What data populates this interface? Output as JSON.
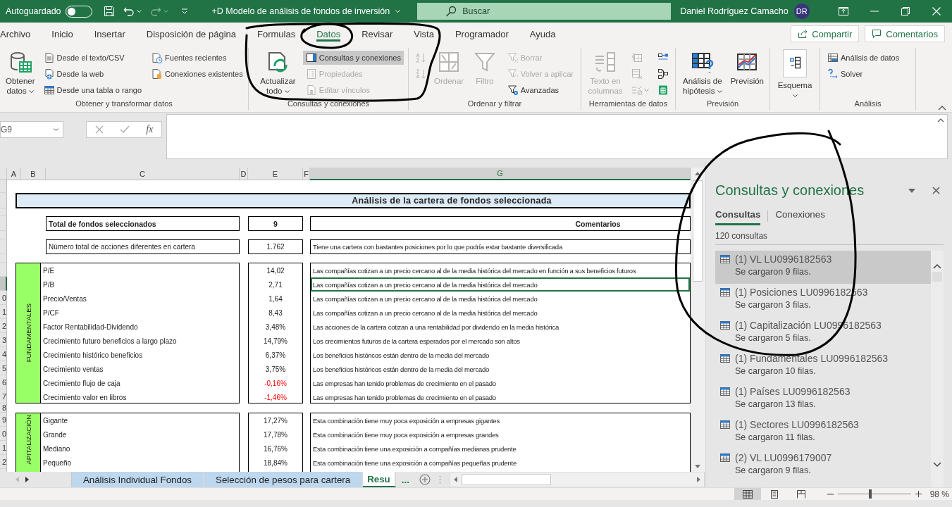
{
  "title_bar": {
    "autosave_label": "Autoguardado",
    "autosave_on": false,
    "document_title": "+D Modelo de análisis de fondos de inversión",
    "search_placeholder": "Buscar",
    "user_name": "Daniel Rodríguez Camacho",
    "user_initials": "DR"
  },
  "ribbon_tabs": [
    {
      "label": "Archivo",
      "selected": false
    },
    {
      "label": "Inicio",
      "selected": false
    },
    {
      "label": "Insertar",
      "selected": false
    },
    {
      "label": "Disposición de página",
      "selected": false
    },
    {
      "label": "Formulas",
      "selected": false
    },
    {
      "label": "Datos",
      "selected": true
    },
    {
      "label": "Revisar",
      "selected": false
    },
    {
      "label": "Vista",
      "selected": false
    },
    {
      "label": "Programador",
      "selected": false
    },
    {
      "label": "Ayuda",
      "selected": false
    }
  ],
  "share_button": "Compartir",
  "comments_button": "Comentarios",
  "ribbon_groups": [
    {
      "label": "Obtener y transformar datos",
      "columns": [
        {
          "kind": "large",
          "label": "Obtener datos",
          "dropdown": true,
          "disabled": false
        },
        {
          "kind": "stack",
          "items": [
            {
              "label": "Desde el texto/CSV",
              "disabled": false
            },
            {
              "label": "Desde la web",
              "disabled": false
            },
            {
              "label": "Desde una tabla o rango",
              "disabled": false
            }
          ]
        },
        {
          "kind": "stack",
          "items": [
            {
              "label": "Fuentes recientes",
              "disabled": false
            },
            {
              "label": "Conexiones existentes",
              "disabled": false
            }
          ]
        }
      ]
    },
    {
      "label": "Consultas y conexiones",
      "columns": [
        {
          "kind": "large",
          "label": "Actualizar todo",
          "dropdown": true,
          "disabled": false
        },
        {
          "kind": "stack",
          "items": [
            {
              "label": "Consultas y conexiones",
              "disabled": false,
              "on": true
            },
            {
              "label": "Propiedades",
              "disabled": true,
              "on": false
            },
            {
              "label": "Editar vínculos",
              "disabled": true,
              "on": false
            }
          ]
        }
      ]
    },
    {
      "label": "Ordenar y filtrar",
      "columns": [
        {
          "kind": "stack",
          "items": [
            {
              "disabled": true
            },
            {
              "disabled": true
            }
          ]
        },
        {
          "kind": "large",
          "label": "Ordenar",
          "disabled": true
        },
        {
          "kind": "large",
          "label": "Filtro",
          "disabled": true
        },
        {
          "kind": "stack",
          "items": [
            {
              "label": "Borrar",
              "disabled": true
            },
            {
              "label": "Volver a aplicar",
              "disabled": true
            },
            {
              "label": "Avanzadas",
              "disabled": false
            }
          ]
        }
      ]
    },
    {
      "label": "Herramientas de datos",
      "columns": [
        {
          "kind": "large",
          "label": "Texto en columnas",
          "disabled": true
        },
        {
          "kind": "stack",
          "items": [
            {
              "disabled": true
            },
            {
              "disabled": true
            },
            {
              "disabled": true,
              "dropdown": true
            }
          ]
        },
        {
          "kind": "stack",
          "items": [
            {
              "disabled": false
            },
            {
              "disabled": false
            },
            {
              "disabled": false
            }
          ]
        }
      ]
    },
    {
      "label": "Previsión",
      "columns": [
        {
          "kind": "large",
          "label": "Análisis de hipótesis",
          "dropdown": true,
          "disabled": false
        },
        {
          "kind": "large",
          "label": "Previsión",
          "disabled": false
        }
      ]
    },
    {
      "columns": [
        {
          "kind": "large",
          "label": "Esquema",
          "dropdown": true,
          "disabled": false
        }
      ]
    },
    {
      "label": "Análisis",
      "columns": [
        {
          "kind": "stack",
          "items": [
            {
              "label": "Análisis de datos",
              "disabled": false
            },
            {
              "label": "Solver",
              "disabled": false
            }
          ]
        }
      ]
    }
  ],
  "formula_bar": {
    "name_box": "G9",
    "function_label": "fx"
  },
  "sheet": {
    "columns": [
      {
        "label": "A",
        "selected": false
      },
      {
        "label": "B",
        "selected": false
      },
      {
        "label": "C",
        "selected": false
      },
      {
        "label": "D",
        "selected": false
      },
      {
        "label": "E",
        "selected": false
      },
      {
        "label": "F",
        "selected": false
      },
      {
        "label": "G",
        "selected": true
      }
    ],
    "row_headers": [
      {
        "selected": false
      },
      {
        "selected": false
      },
      {
        "selected": false
      },
      {
        "selected": false
      },
      {
        "selected": false
      },
      {
        "selected": false
      },
      {
        "selected": false
      },
      {
        "selected": false
      },
      {
        "selected": true
      },
      {
        "label": "0",
        "selected": false
      },
      {
        "label": "1",
        "selected": false
      },
      {
        "label": "2",
        "selected": false
      },
      {
        "label": "3",
        "selected": false
      },
      {
        "label": "4",
        "selected": false
      },
      {
        "label": "5",
        "selected": false
      },
      {
        "label": "6",
        "selected": false
      },
      {
        "label": "7",
        "selected": false
      },
      {
        "label": "8",
        "selected": false
      },
      {
        "label": "9",
        "selected": false
      },
      {
        "label": "0",
        "selected": false
      },
      {
        "label": "1",
        "selected": false
      },
      {
        "label": "2",
        "selected": false
      },
      {
        "selected": false
      }
    ],
    "title": "Análisis de la cartera de fondos seleccionada",
    "total": {
      "label": "Total de fondos seleccionados",
      "value": "9",
      "comment_header": "Comentarios"
    },
    "summary": {
      "label": "Número total de acciones diferentes en cartera",
      "value": "1.762",
      "comment": "Tiene una cartera con bastantes posiciones por lo que podría estar bastante diversificada"
    },
    "sections": [
      {
        "label": "FUNDAMENTALES",
        "rows": [
          {
            "metric": "P/E",
            "value": "14,02",
            "negative": false,
            "selected": false,
            "comment": "Las compañías cotizan a un precio cercano al de la media histórica del mercado en función a sus beneficios futuros"
          },
          {
            "metric": "P/B",
            "value": "2,71",
            "negative": false,
            "selected": true,
            "comment": "Las compañías cotizan a un precio cercano al de la media histórica del mercado"
          },
          {
            "metric": "Precio/Ventas",
            "value": "1,64",
            "negative": false,
            "selected": false,
            "comment": "Las compañías cotizan a un precio cercano al de la media histórica del mercado"
          },
          {
            "metric": "P/CF",
            "value": "8,43",
            "negative": false,
            "selected": false,
            "comment": "Las compañías cotizan a un precio cercano al de la media histórica del mercado"
          },
          {
            "metric": "Factor Rentabilidad-Dividendo",
            "value": "3,48%",
            "negative": false,
            "selected": false,
            "comment": "Las acciones de la cartera cotizan a una rentabilidad por dividendo en la media histórica"
          },
          {
            "metric": "Crecimiento futuro beneficios a largo plazo",
            "value": "14,79%",
            "negative": false,
            "selected": false,
            "comment": "Los crecimientos futuros de la cartera esperados por el mercado son altos"
          },
          {
            "metric": "Crecimiento histórico beneficios",
            "value": "6,37%",
            "negative": false,
            "selected": false,
            "comment": "Los beneficios históricos están dentro de la media del mercado"
          },
          {
            "metric": "Crecimiento ventas",
            "value": "3,75%",
            "negative": false,
            "selected": false,
            "comment": "Los beneficios históricos están dentro de la media del mercado"
          },
          {
            "metric": "Crecimiento flujo de caja",
            "value": "-0,16%",
            "negative": true,
            "selected": false,
            "comment": "Las empresas han tenido problemas de crecimiento en el pasado"
          },
          {
            "metric": "Crecimiento valor en libros",
            "value": "-1,46%",
            "negative": true,
            "selected": false,
            "comment": "Las empresas han tenido problemas de crecimiento en el pasado"
          }
        ]
      },
      {
        "label": "APITALIZACIÓN",
        "rows": [
          {
            "metric": "Gigante",
            "value": "17,27%",
            "negative": false,
            "selected": false,
            "comment": "Esta combinación tiene muy poca exposición a empresas gigantes"
          },
          {
            "metric": "Grande",
            "value": "17,78%",
            "negative": false,
            "selected": false,
            "comment": "Esta combinación tiene muy poca exposición a empresas grandes"
          },
          {
            "metric": "Mediano",
            "value": "16,76%",
            "negative": false,
            "selected": false,
            "comment": "Esta combinación tiene una exposición a compañías medianas prudente"
          },
          {
            "metric": "Pequeño",
            "value": "18,84%",
            "negative": false,
            "selected": false,
            "comment": "Esta combinación tiene una exposición a compañías pequeñas prudente"
          }
        ]
      }
    ]
  },
  "sheet_tabs": [
    {
      "label": "Análisis Individual Fondos",
      "selected": false
    },
    {
      "label": "Selección de pesos para cartera",
      "selected": false
    },
    {
      "label": "Resu",
      "selected": true
    }
  ],
  "more_tabs": "...",
  "queries_pane": {
    "title": "Consultas y conexiones",
    "tabs": [
      {
        "label": "Consultas",
        "selected": true
      },
      {
        "label": "Conexiones",
        "selected": false
      }
    ],
    "count": "120 consultas",
    "queries": [
      {
        "name": "(1) VL LU0996182563",
        "status": "Se cargaron 9 filas.",
        "selected": true
      },
      {
        "name": "(1) Posiciones LU0996182563",
        "status": "Se cargaron 3 filas.",
        "selected": false
      },
      {
        "name": "(1) Capitalización LU0996182563",
        "status": "Se cargaron 5 filas.",
        "selected": false
      },
      {
        "name": "(1) Fundamentales LU0996182563",
        "status": "Se cargaron 10 filas.",
        "selected": false
      },
      {
        "name": "(1) Países LU0996182563",
        "status": "Se cargaron 13 filas.",
        "selected": false
      },
      {
        "name": "(1) Sectores LU0996182563",
        "status": "Se cargaron 11 filas.",
        "selected": false
      },
      {
        "name": "(2) VL LU0996179007",
        "status": "Se cargaron 9 filas.",
        "selected": false
      }
    ]
  },
  "status_bar": {
    "views": [
      {
        "selected": true
      },
      {
        "selected": false
      },
      {
        "selected": false
      }
    ],
    "zoom": {
      "level": 0.45,
      "reading": "98 %"
    }
  },
  "annotations": [
    {
      "kind": "ink-loop"
    },
    {
      "kind": "ink-loop"
    },
    {
      "kind": "ink-loop"
    }
  ]
}
